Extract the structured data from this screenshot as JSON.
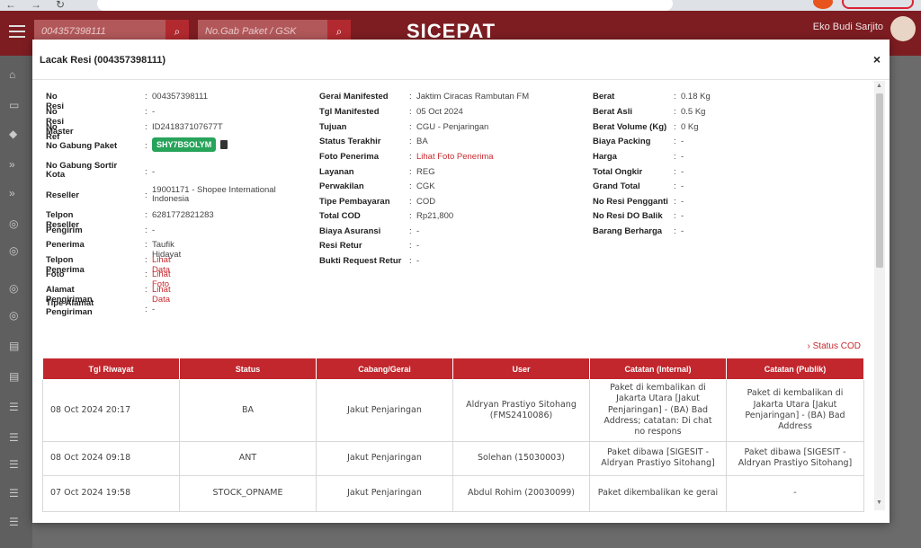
{
  "header": {
    "search_value": "004357398111",
    "gabung_placeholder": "No.Gab Paket / GSK",
    "logo_text": "SICEPAT",
    "user_name": "Eko Budi Sarjito"
  },
  "modal": {
    "title": "Lacak Resi (004357398111)",
    "close": "×",
    "col1": [
      {
        "label": "No Resi",
        "value": "004357398111"
      },
      {
        "label": "No Resi Master",
        "value": "-"
      },
      {
        "label": "No Ref",
        "value": "ID241837107677T"
      },
      {
        "label": "No Gabung Paket",
        "value": "SHY7BSOLYM"
      },
      {
        "label": "No Gabung Sortir Kota",
        "value": "-"
      },
      {
        "label": "Reseller",
        "value": "19001171 - Shopee International Indonesia"
      },
      {
        "label": "Telpon Reseller",
        "value": "6281772821283"
      },
      {
        "label": "Pengirim",
        "value": "-"
      },
      {
        "label": "Penerima",
        "value": "Taufik Hidayat"
      },
      {
        "label": "Telpon Penerima",
        "value": "Lihat Data"
      },
      {
        "label": "Foto",
        "value": "Lihat Foto"
      },
      {
        "label": "Alamat Pengiriman",
        "value": "Lihat Data"
      },
      {
        "label": "Tipe Alamat Pengiriman",
        "value": "-"
      }
    ],
    "col2": [
      {
        "label": "Gerai Manifested",
        "value": "Jaktim Ciracas Rambutan FM"
      },
      {
        "label": "Tgl Manifested",
        "value": "05 Oct 2024"
      },
      {
        "label": "Tujuan",
        "value": "CGU - Penjaringan"
      },
      {
        "label": "Status Terakhir",
        "value": "BA"
      },
      {
        "label": "Foto Penerima",
        "value": "Lihat Foto Penerima"
      },
      {
        "label": "Layanan",
        "value": "REG"
      },
      {
        "label": "Perwakilan",
        "value": "CGK"
      },
      {
        "label": "Tipe Pembayaran",
        "value": "COD"
      },
      {
        "label": "Total COD",
        "value": "Rp21,800"
      },
      {
        "label": "Biaya Asuransi",
        "value": "-"
      },
      {
        "label": "Resi Retur",
        "value": "-"
      },
      {
        "label": "Bukti Request Retur",
        "value": "-"
      }
    ],
    "col3": [
      {
        "label": "Berat",
        "value": "0.18 Kg"
      },
      {
        "label": "Berat Asli",
        "value": "0.5 Kg"
      },
      {
        "label": "Berat Volume (Kg)",
        "value": "0 Kg"
      },
      {
        "label": "Biaya Packing",
        "value": "-"
      },
      {
        "label": "Harga",
        "value": "-"
      },
      {
        "label": "Total Ongkir",
        "value": "-"
      },
      {
        "label": "Grand Total",
        "value": "-"
      },
      {
        "label": "No Resi Pengganti",
        "value": "-"
      },
      {
        "label": "No Resi DO Balik",
        "value": "-"
      },
      {
        "label": "Barang Berharga",
        "value": "-"
      }
    ],
    "status_cod_link": "› Status COD",
    "history": {
      "headers": [
        "Tgl Riwayat",
        "Status",
        "Cabang/Gerai",
        "User",
        "Catatan (Internal)",
        "Catatan (Publik)"
      ],
      "rows": [
        {
          "date": "08 Oct 2024 20:17",
          "status": "BA",
          "cabang": "Jakut Penjaringan",
          "user": "Aldryan Prastiyo Sitohang (FMS2410086)",
          "internal": "Paket di kembalikan di Jakarta Utara [Jakut Penjaringan] - (BA) Bad Address; catatan: Di chat no respons",
          "publik": "Paket di kembalikan di Jakarta Utara [Jakut Penjaringan] - (BA) Bad Address"
        },
        {
          "date": "08 Oct 2024 09:18",
          "status": "ANT",
          "cabang": "Jakut Penjaringan",
          "user": "Solehan (15030003)",
          "internal": "Paket dibawa [SIGESIT - Aldryan Prastiyo Sitohang]",
          "publik": "Paket dibawa [SIGESIT - Aldryan Prastiyo Sitohang]"
        },
        {
          "date": "07 Oct 2024 19:58",
          "status": "STOCK_OPNAME",
          "cabang": "Jakut Penjaringan",
          "user": "Abdul Rohim (20030099)",
          "internal": "Paket dikembalikan ke gerai",
          "publik": "-"
        }
      ]
    }
  }
}
